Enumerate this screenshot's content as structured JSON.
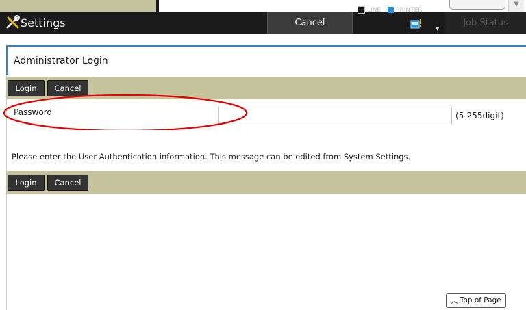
{
  "header": {
    "app_title": "Settings",
    "cancel_label": "Cancel",
    "job_status_label": "Job Status",
    "legend": [
      {
        "label": "LINE",
        "color": "#1b1b1b"
      },
      {
        "label": "PRINTER",
        "color": "#2a8fd8"
      }
    ],
    "printer_icon": "printer-icon"
  },
  "page": {
    "title": "Administrator Login",
    "accent_color": "#3b7fc6",
    "bar_color": "#c6c49c"
  },
  "buttons": {
    "login_label": "Login",
    "cancel_label": "Cancel"
  },
  "form": {
    "password_label": "Password",
    "password_value": "",
    "password_hint": "(5-255digit)"
  },
  "message": "Please enter the User Authentication information. This message can be edited from System Settings.",
  "footer": {
    "top_of_page_label": "Top of Page"
  }
}
